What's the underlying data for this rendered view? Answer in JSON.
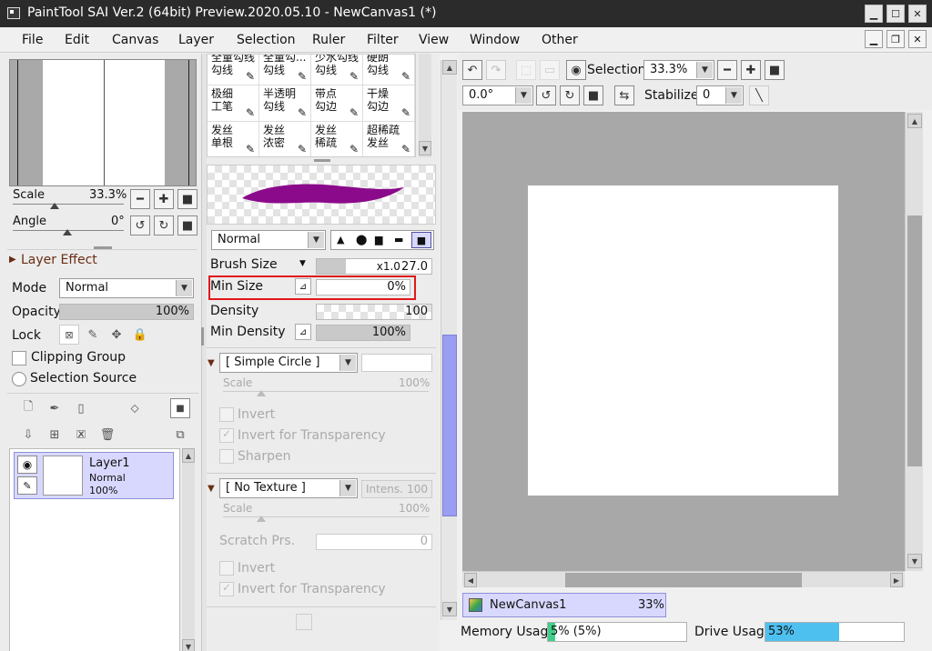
{
  "window": {
    "title": "PaintTool SAI Ver.2 (64bit) Preview.2020.05.10 - NewCanvas1 (*)"
  },
  "menu": [
    "File",
    "Edit",
    "Canvas",
    "Layer",
    "Selection",
    "Ruler",
    "Filter",
    "View",
    "Window",
    "Other"
  ],
  "navigator": {
    "scale_label": "Scale",
    "scale_value": "33.3%",
    "angle_label": "Angle",
    "angle_value": "0°"
  },
  "layer_panel": {
    "effect_header": "Layer Effect",
    "mode_label": "Mode",
    "mode_value": "Normal",
    "opacity_label": "Opacity",
    "opacity_value": "100%",
    "lock_label": "Lock",
    "clipping_label": "Clipping Group",
    "selection_source_label": "Selection Source",
    "layer": {
      "name": "Layer1",
      "mode": "Normal",
      "opacity": "100%"
    }
  },
  "brush_presets": [
    [
      "全童勾线",
      "全童勾...",
      "少水勾线",
      "硬朗"
    ],
    [
      "勾线",
      "勾线",
      "勾线",
      "勾线"
    ],
    [
      "极细",
      "半透明",
      "带点",
      "干燥"
    ],
    [
      "工笔",
      "勾线",
      "勾边",
      "勾边"
    ],
    [
      "发丝",
      "发丝",
      "发丝",
      "超稀疏"
    ],
    [
      "单根",
      "浓密",
      "稀疏",
      "发丝"
    ]
  ],
  "brush_settings": {
    "blend_mode": "Normal",
    "brush_size_label": "Brush Size",
    "brush_size_multiplier": "x1.0",
    "brush_size_value": "27.0",
    "min_size_label": "Min Size",
    "min_size_value": "0%",
    "density_label": "Density",
    "density_value": "100",
    "min_density_label": "Min Density",
    "min_density_value": "100%",
    "shape_value": "[ Simple Circle ]",
    "shape_scale_label": "Scale",
    "shape_scale_value": "100%",
    "invert_label": "Invert",
    "invert_transparency_label": "Invert for Transparency",
    "sharpen_label": "Sharpen",
    "texture_value": "[ No Texture ]",
    "intens_label": "Intens.",
    "intens_value": "100",
    "texture_scale_label": "Scale",
    "texture_scale_value": "100%",
    "scratch_label": "Scratch Prs.",
    "scratch_value": "0",
    "invert2_label": "Invert",
    "invert_transparency2_label": "Invert for Transparency"
  },
  "canvas_toolbar": {
    "selection_label": "Selection",
    "zoom_value": "33.3%",
    "angle_value": "0.0°",
    "stabilizer_label": "Stabilizer",
    "stabilizer_value": "0"
  },
  "canvas_tab": {
    "name": "NewCanvas1",
    "zoom": "33%"
  },
  "status": {
    "memory_label": "Memory Usage",
    "memory_value": "5% (5%)",
    "drive_label": "Drive Usage",
    "drive_value": "53%",
    "memory_fraction": 0.05,
    "drive_fraction": 0.53
  },
  "colors": {
    "purple_stroke": "#8b0a8b",
    "selection_blue": "#d8d8ff",
    "memory_green": "#3fcf8a",
    "drive_blue": "#4ec0f0",
    "highlight_red": "#e0181b"
  }
}
